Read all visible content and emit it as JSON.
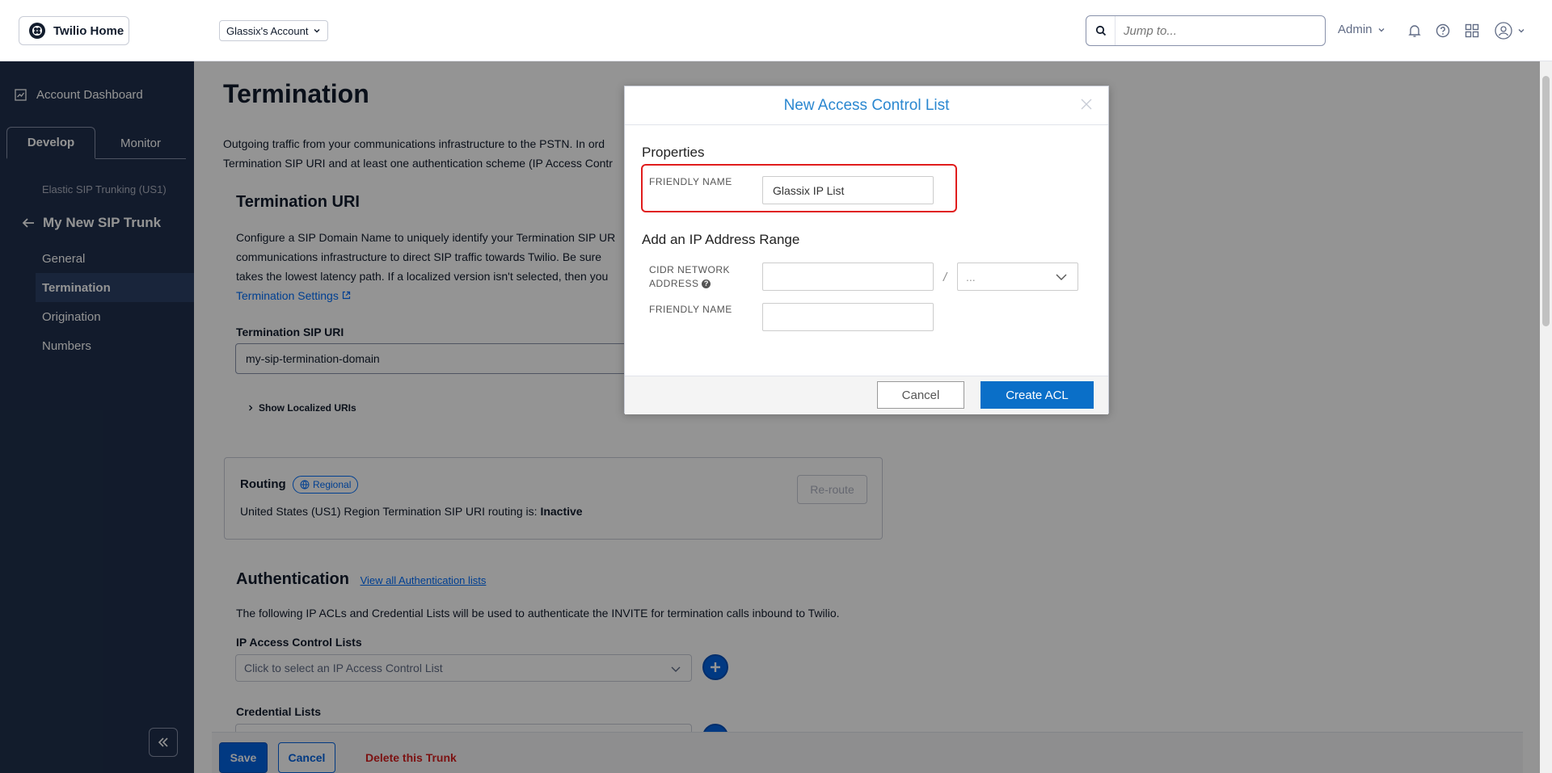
{
  "topbar": {
    "home_label": "Twilio Home",
    "account_label": "Glassix's Account",
    "search_placeholder": "Jump to...",
    "admin_label": "Admin"
  },
  "sidebar": {
    "dashboard_label": "Account Dashboard",
    "tabs": [
      "Develop",
      "Monitor"
    ],
    "product": "Elastic SIP Trunking (US1)",
    "trunk_name": "My New SIP Trunk",
    "items": [
      "General",
      "Termination",
      "Origination",
      "Numbers"
    ],
    "active_item": "Termination"
  },
  "main": {
    "title": "Termination",
    "intro_line1": "Outgoing traffic from your communications infrastructure to the PSTN. In ord",
    "intro_line2": "Termination SIP URI and at least one authentication scheme (IP Access Contr",
    "uri_heading": "Termination URI",
    "uri_para_line1": "Configure a SIP Domain Name to uniquely identify your Termination SIP UR",
    "uri_para_line2": "communications infrastructure to direct SIP traffic towards Twilio. Be sure",
    "uri_para_line3": "takes the lowest latency path. If a localized version isn't selected, then you",
    "uri_settings_link": "Termination Settings",
    "uri_label": "Termination SIP URI",
    "uri_value": "my-sip-termination-domain",
    "show_localized": "Show Localized URIs",
    "routing": {
      "title": "Routing",
      "badge": "Regional",
      "text_prefix": "United States (US1) Region Termination SIP URI routing is:",
      "status": "Inactive",
      "reroute_label": "Re-route"
    },
    "auth": {
      "heading": "Authentication",
      "view_all_link": "View all Authentication lists",
      "description": "The following IP ACLs and Credential Lists will be used to authenticate the INVITE for termination calls inbound to Twilio.",
      "ip_acl_label": "IP Access Control Lists",
      "ip_acl_placeholder": "Click to select an IP Access Control List",
      "cred_label": "Credential Lists"
    },
    "bottom": {
      "save": "Save",
      "cancel": "Cancel",
      "delete": "Delete this Trunk"
    }
  },
  "modal": {
    "title": "New Access Control List",
    "properties_heading": "Properties",
    "friendly_name_label": "FRIENDLY NAME",
    "friendly_name_value": "Glassix IP List",
    "range_heading": "Add an IP Address Range",
    "cidr_label_line1": "CIDR NETWORK",
    "cidr_label_line2": "ADDRESS",
    "cidr_value": "",
    "slash": "/",
    "prefix_placeholder": "...",
    "range_friendly_label": "FRIENDLY NAME",
    "range_friendly_value": "",
    "cancel_label": "Cancel",
    "create_label": "Create ACL"
  },
  "colors": {
    "sidebar_bg": "#1f304c",
    "primary": "#0263e0",
    "modal_title": "#2a87d0",
    "highlight": "#e01d1d",
    "danger": "#d61f1f"
  }
}
